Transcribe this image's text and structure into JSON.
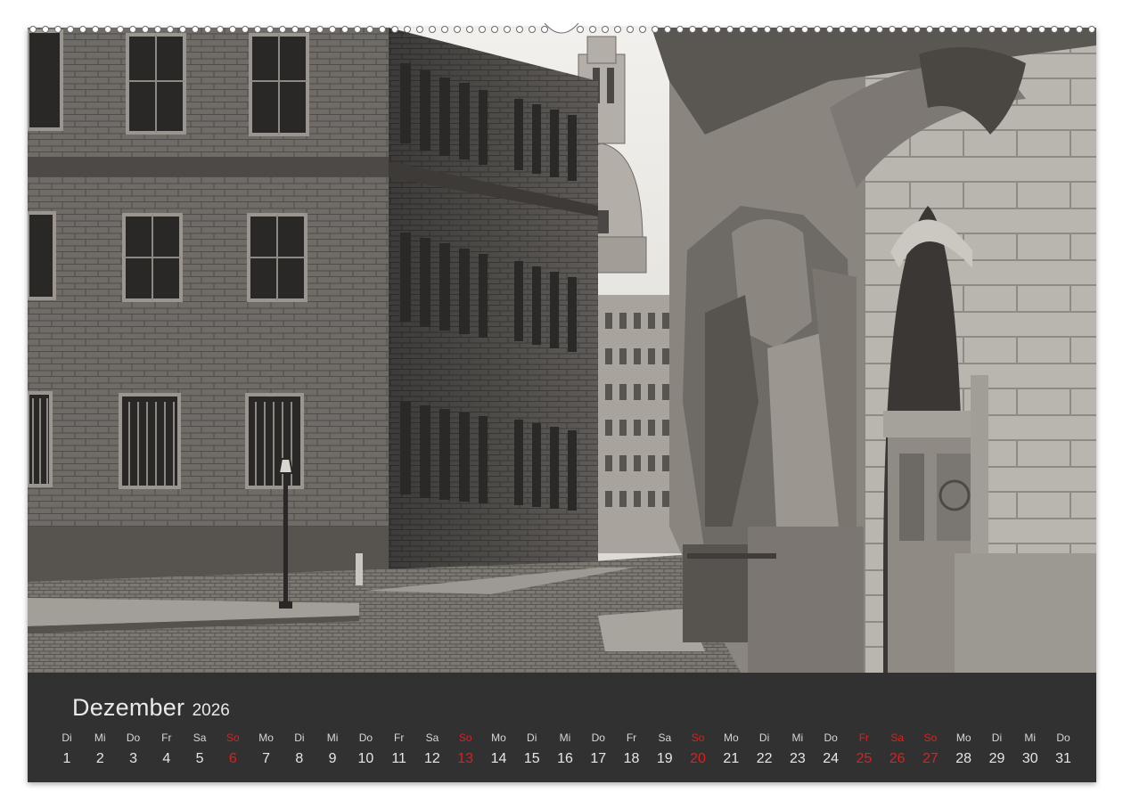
{
  "calendar": {
    "month": "Dezember",
    "year": "2026",
    "accent_color": "#e01e1e",
    "days": [
      {
        "wd": "Di",
        "num": "1",
        "red": false
      },
      {
        "wd": "Mi",
        "num": "2",
        "red": false
      },
      {
        "wd": "Do",
        "num": "3",
        "red": false
      },
      {
        "wd": "Fr",
        "num": "4",
        "red": false
      },
      {
        "wd": "Sa",
        "num": "5",
        "red": false
      },
      {
        "wd": "So",
        "num": "6",
        "red": true
      },
      {
        "wd": "Mo",
        "num": "7",
        "red": false
      },
      {
        "wd": "Di",
        "num": "8",
        "red": false
      },
      {
        "wd": "Mi",
        "num": "9",
        "red": false
      },
      {
        "wd": "Do",
        "num": "10",
        "red": false
      },
      {
        "wd": "Fr",
        "num": "11",
        "red": false
      },
      {
        "wd": "Sa",
        "num": "12",
        "red": false
      },
      {
        "wd": "So",
        "num": "13",
        "red": true
      },
      {
        "wd": "Mo",
        "num": "14",
        "red": false
      },
      {
        "wd": "Di",
        "num": "15",
        "red": false
      },
      {
        "wd": "Mi",
        "num": "16",
        "red": false
      },
      {
        "wd": "Do",
        "num": "17",
        "red": false
      },
      {
        "wd": "Fr",
        "num": "18",
        "red": false
      },
      {
        "wd": "Sa",
        "num": "19",
        "red": false
      },
      {
        "wd": "So",
        "num": "20",
        "red": true
      },
      {
        "wd": "Mo",
        "num": "21",
        "red": false
      },
      {
        "wd": "Di",
        "num": "22",
        "red": false
      },
      {
        "wd": "Mi",
        "num": "23",
        "red": false
      },
      {
        "wd": "Do",
        "num": "24",
        "red": false
      },
      {
        "wd": "Fr",
        "num": "25",
        "red": true
      },
      {
        "wd": "Sa",
        "num": "26",
        "red": true
      },
      {
        "wd": "So",
        "num": "27",
        "red": true
      },
      {
        "wd": "Mo",
        "num": "28",
        "red": false
      },
      {
        "wd": "Di",
        "num": "29",
        "red": false
      },
      {
        "wd": "Mi",
        "num": "30",
        "red": false
      },
      {
        "wd": "Do",
        "num": "31",
        "red": false
      }
    ]
  }
}
